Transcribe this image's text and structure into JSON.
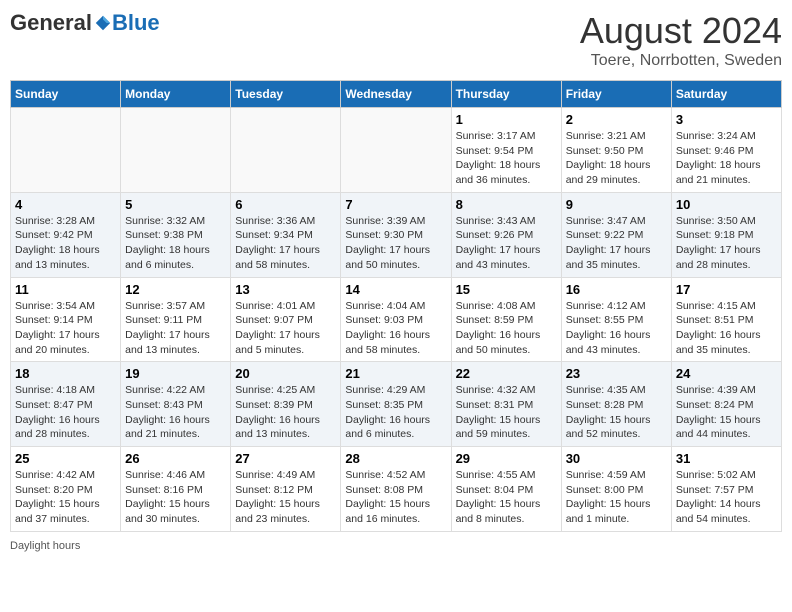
{
  "header": {
    "logo_general": "General",
    "logo_blue": "Blue",
    "month_title": "August 2024",
    "location": "Toere, Norrbotten, Sweden"
  },
  "days_of_week": [
    "Sunday",
    "Monday",
    "Tuesday",
    "Wednesday",
    "Thursday",
    "Friday",
    "Saturday"
  ],
  "footer": {
    "daylight_label": "Daylight hours"
  },
  "weeks": [
    [
      {
        "day": "",
        "empty": true
      },
      {
        "day": "",
        "empty": true
      },
      {
        "day": "",
        "empty": true
      },
      {
        "day": "",
        "empty": true
      },
      {
        "day": "1",
        "sunrise": "Sunrise: 3:17 AM",
        "sunset": "Sunset: 9:54 PM",
        "daylight": "Daylight: 18 hours and 36 minutes."
      },
      {
        "day": "2",
        "sunrise": "Sunrise: 3:21 AM",
        "sunset": "Sunset: 9:50 PM",
        "daylight": "Daylight: 18 hours and 29 minutes."
      },
      {
        "day": "3",
        "sunrise": "Sunrise: 3:24 AM",
        "sunset": "Sunset: 9:46 PM",
        "daylight": "Daylight: 18 hours and 21 minutes."
      }
    ],
    [
      {
        "day": "4",
        "sunrise": "Sunrise: 3:28 AM",
        "sunset": "Sunset: 9:42 PM",
        "daylight": "Daylight: 18 hours and 13 minutes."
      },
      {
        "day": "5",
        "sunrise": "Sunrise: 3:32 AM",
        "sunset": "Sunset: 9:38 PM",
        "daylight": "Daylight: 18 hours and 6 minutes."
      },
      {
        "day": "6",
        "sunrise": "Sunrise: 3:36 AM",
        "sunset": "Sunset: 9:34 PM",
        "daylight": "Daylight: 17 hours and 58 minutes."
      },
      {
        "day": "7",
        "sunrise": "Sunrise: 3:39 AM",
        "sunset": "Sunset: 9:30 PM",
        "daylight": "Daylight: 17 hours and 50 minutes."
      },
      {
        "day": "8",
        "sunrise": "Sunrise: 3:43 AM",
        "sunset": "Sunset: 9:26 PM",
        "daylight": "Daylight: 17 hours and 43 minutes."
      },
      {
        "day": "9",
        "sunrise": "Sunrise: 3:47 AM",
        "sunset": "Sunset: 9:22 PM",
        "daylight": "Daylight: 17 hours and 35 minutes."
      },
      {
        "day": "10",
        "sunrise": "Sunrise: 3:50 AM",
        "sunset": "Sunset: 9:18 PM",
        "daylight": "Daylight: 17 hours and 28 minutes."
      }
    ],
    [
      {
        "day": "11",
        "sunrise": "Sunrise: 3:54 AM",
        "sunset": "Sunset: 9:14 PM",
        "daylight": "Daylight: 17 hours and 20 minutes."
      },
      {
        "day": "12",
        "sunrise": "Sunrise: 3:57 AM",
        "sunset": "Sunset: 9:11 PM",
        "daylight": "Daylight: 17 hours and 13 minutes."
      },
      {
        "day": "13",
        "sunrise": "Sunrise: 4:01 AM",
        "sunset": "Sunset: 9:07 PM",
        "daylight": "Daylight: 17 hours and 5 minutes."
      },
      {
        "day": "14",
        "sunrise": "Sunrise: 4:04 AM",
        "sunset": "Sunset: 9:03 PM",
        "daylight": "Daylight: 16 hours and 58 minutes."
      },
      {
        "day": "15",
        "sunrise": "Sunrise: 4:08 AM",
        "sunset": "Sunset: 8:59 PM",
        "daylight": "Daylight: 16 hours and 50 minutes."
      },
      {
        "day": "16",
        "sunrise": "Sunrise: 4:12 AM",
        "sunset": "Sunset: 8:55 PM",
        "daylight": "Daylight: 16 hours and 43 minutes."
      },
      {
        "day": "17",
        "sunrise": "Sunrise: 4:15 AM",
        "sunset": "Sunset: 8:51 PM",
        "daylight": "Daylight: 16 hours and 35 minutes."
      }
    ],
    [
      {
        "day": "18",
        "sunrise": "Sunrise: 4:18 AM",
        "sunset": "Sunset: 8:47 PM",
        "daylight": "Daylight: 16 hours and 28 minutes."
      },
      {
        "day": "19",
        "sunrise": "Sunrise: 4:22 AM",
        "sunset": "Sunset: 8:43 PM",
        "daylight": "Daylight: 16 hours and 21 minutes."
      },
      {
        "day": "20",
        "sunrise": "Sunrise: 4:25 AM",
        "sunset": "Sunset: 8:39 PM",
        "daylight": "Daylight: 16 hours and 13 minutes."
      },
      {
        "day": "21",
        "sunrise": "Sunrise: 4:29 AM",
        "sunset": "Sunset: 8:35 PM",
        "daylight": "Daylight: 16 hours and 6 minutes."
      },
      {
        "day": "22",
        "sunrise": "Sunrise: 4:32 AM",
        "sunset": "Sunset: 8:31 PM",
        "daylight": "Daylight: 15 hours and 59 minutes."
      },
      {
        "day": "23",
        "sunrise": "Sunrise: 4:35 AM",
        "sunset": "Sunset: 8:28 PM",
        "daylight": "Daylight: 15 hours and 52 minutes."
      },
      {
        "day": "24",
        "sunrise": "Sunrise: 4:39 AM",
        "sunset": "Sunset: 8:24 PM",
        "daylight": "Daylight: 15 hours and 44 minutes."
      }
    ],
    [
      {
        "day": "25",
        "sunrise": "Sunrise: 4:42 AM",
        "sunset": "Sunset: 8:20 PM",
        "daylight": "Daylight: 15 hours and 37 minutes."
      },
      {
        "day": "26",
        "sunrise": "Sunrise: 4:46 AM",
        "sunset": "Sunset: 8:16 PM",
        "daylight": "Daylight: 15 hours and 30 minutes."
      },
      {
        "day": "27",
        "sunrise": "Sunrise: 4:49 AM",
        "sunset": "Sunset: 8:12 PM",
        "daylight": "Daylight: 15 hours and 23 minutes."
      },
      {
        "day": "28",
        "sunrise": "Sunrise: 4:52 AM",
        "sunset": "Sunset: 8:08 PM",
        "daylight": "Daylight: 15 hours and 16 minutes."
      },
      {
        "day": "29",
        "sunrise": "Sunrise: 4:55 AM",
        "sunset": "Sunset: 8:04 PM",
        "daylight": "Daylight: 15 hours and 8 minutes."
      },
      {
        "day": "30",
        "sunrise": "Sunrise: 4:59 AM",
        "sunset": "Sunset: 8:00 PM",
        "daylight": "Daylight: 15 hours and 1 minute."
      },
      {
        "day": "31",
        "sunrise": "Sunrise: 5:02 AM",
        "sunset": "Sunset: 7:57 PM",
        "daylight": "Daylight: 14 hours and 54 minutes."
      }
    ]
  ]
}
